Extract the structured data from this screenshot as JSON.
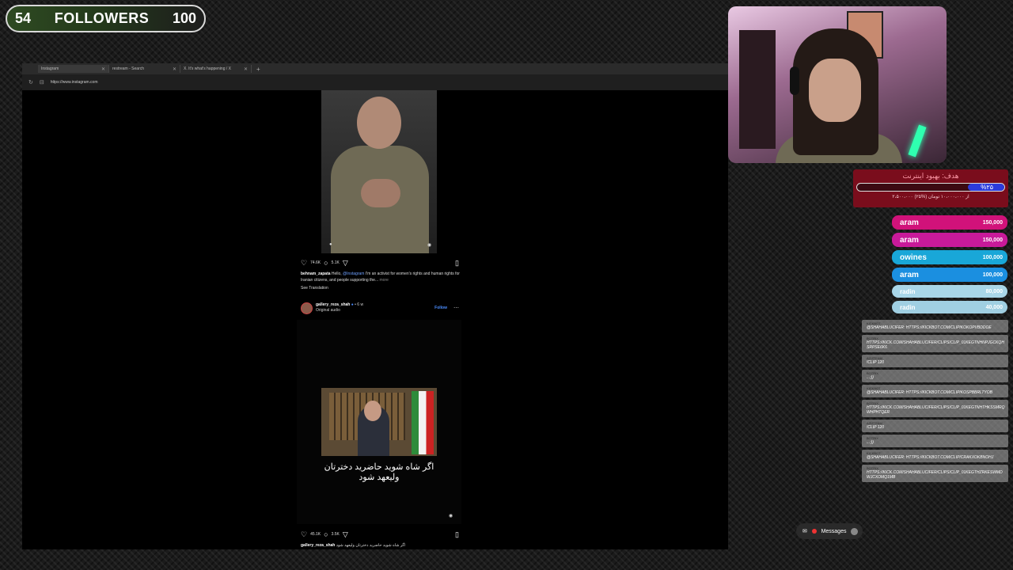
{
  "followers": {
    "current": "54",
    "label": "FOLLOWERS",
    "goal": "100"
  },
  "browser": {
    "tabs": [
      {
        "title": "Instagram"
      },
      {
        "title": "restream - Search"
      },
      {
        "title": "X. It's what's happening / X"
      }
    ],
    "url": "https://www.instagram.com"
  },
  "post1": {
    "likes": "74.6K",
    "comments": "5.1K",
    "username": "behnam_zapata",
    "caption_prefix": "Hello,",
    "caption_tag": "@Instagram",
    "caption_text": "I'm an activist for women's rights and human rights for Iranian citizens, and people supporting the...",
    "more": "more",
    "see_translation": "See Translation"
  },
  "post2": {
    "username": "gallery_reza_shah",
    "time": "• 6 w",
    "audio": "Original audio",
    "follow": "Follow",
    "overlay_line1": "اگر شاه شوید حاضرید دخترتان",
    "overlay_line2": "ولیعهد شود",
    "likes": "45.1K",
    "comments": "3.5K",
    "caption_user": "gallery_reza_shah",
    "caption_text": "اگر شاه شوید حاضرید دخترتان ولیعهد شود"
  },
  "goal": {
    "title": "هدف: بهبود اینترنت",
    "percent": "%۲۵",
    "percent_value": 25,
    "subtitle": "۲،۵۰۰،۰۰۰ از ۱۰،۰۰۰،۰۰۰ تومان (%۲۵)",
    "fill_color": "#2b3bdc"
  },
  "donors": [
    {
      "name": "aram",
      "amount": "150,000",
      "color": "#d1127a"
    },
    {
      "name": "aram",
      "amount": "150,000",
      "color": "#c81a9a"
    },
    {
      "name": "owines",
      "amount": "100,000",
      "color": "#19a7d8"
    },
    {
      "name": "aram",
      "amount": "100,000",
      "color": "#1b8fe0"
    },
    {
      "name": "radin",
      "amount": "80,000",
      "color": "#a9d6e8"
    },
    {
      "name": "radin",
      "amount": "40,000",
      "color": "#a0cfe2"
    }
  ],
  "chat": [
    {
      "user": "KICKBOT",
      "text": "@SHAHABLUCIFER: HTTPS://KICKBOT.COM/CLIP/KOKOPVBDDOE"
    },
    {
      "user": "BOTRIX",
      "text": "HTTPS://KICK.COM/SHAHABLUCIFER/CLIPS/CLIP_01KEGTNHNPJGCKQHSRPSE6K6"
    },
    {
      "user": "AZIZTEAM",
      "text": "!CLIP 120"
    },
    {
      "user": "BOTRIX",
      "text": "...:))"
    },
    {
      "user": "KICKBOT",
      "text": "@SHAHABLUCIFER: HTTPS://KICKBOT.COM/CLIP/KOSPBBRLTYOB"
    },
    {
      "user": "BOTRIX",
      "text": "HTTPS://KICK.COM/SHAHABLUCIFER/CLIPS/CLIP_01KEGTNHTHKSSMRQWHPHTQER"
    },
    {
      "user": "AZIZTEAM",
      "text": "!CLIP 120"
    },
    {
      "user": "BOTRIX",
      "text": "...:))"
    },
    {
      "user": "KICKBOT",
      "text": "@SHAHABLUCIFER: HTTPS://KICKBOT.COM/CLIP/CRAKXOKBNOHJ"
    },
    {
      "user": "BOTRIX",
      "text": "HTTPS://KICK.COM/SHAHABLUCIFER/CLIPS/CLIP_01KEGTHZRKESWMDWJCXOMQ1MB"
    }
  ],
  "messages": {
    "label": "Messages",
    "badge": "1"
  }
}
